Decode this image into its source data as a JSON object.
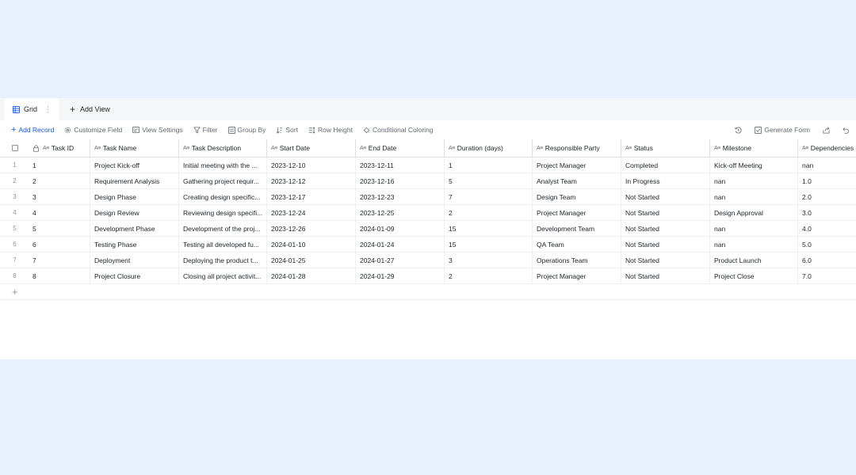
{
  "tabs": {
    "grid_label": "Grid",
    "add_view_label": "Add View"
  },
  "toolbar": {
    "add_record": "Add Record",
    "customize_field": "Customize Field",
    "view_settings": "View Settings",
    "filter": "Filter",
    "group_by": "Group By",
    "sort": "Sort",
    "row_height": "Row Height",
    "conditional_coloring": "Conditional Coloring",
    "generate_form": "Generate Form"
  },
  "columns": {
    "task_id": "Task ID",
    "task_name": "Task Name",
    "task_description": "Task Description",
    "start_date": "Start Date",
    "end_date": "End Date",
    "duration": "Duration (days)",
    "responsible_party": "Responsible Party",
    "status": "Status",
    "milestone": "Milestone",
    "dependencies": "Dependencies"
  },
  "rows": [
    {
      "idx": "1",
      "task_id": "1",
      "task_name": "Project Kick-off",
      "task_description": "Initial meeting with the ...",
      "start_date": "2023-12-10",
      "end_date": "2023-12-11",
      "duration": "1",
      "responsible_party": "Project Manager",
      "status": "Completed",
      "milestone": "Kick-off Meeting",
      "dependencies": "nan"
    },
    {
      "idx": "2",
      "task_id": "2",
      "task_name": "Requirement Analysis",
      "task_description": "Gathering project requir...",
      "start_date": "2023-12-12",
      "end_date": "2023-12-16",
      "duration": "5",
      "responsible_party": "Analyst Team",
      "status": "In Progress",
      "milestone": "nan",
      "dependencies": "1.0"
    },
    {
      "idx": "3",
      "task_id": "3",
      "task_name": "Design Phase",
      "task_description": "Creating design specific...",
      "start_date": "2023-12-17",
      "end_date": "2023-12-23",
      "duration": "7",
      "responsible_party": "Design Team",
      "status": "Not Started",
      "milestone": "nan",
      "dependencies": "2.0"
    },
    {
      "idx": "4",
      "task_id": "4",
      "task_name": "Design Review",
      "task_description": "Reviewing design specifi...",
      "start_date": "2023-12-24",
      "end_date": "2023-12-25",
      "duration": "2",
      "responsible_party": "Project Manager",
      "status": "Not Started",
      "milestone": "Design Approval",
      "dependencies": "3.0"
    },
    {
      "idx": "5",
      "task_id": "5",
      "task_name": "Development Phase",
      "task_description": "Development of the proj...",
      "start_date": "2023-12-26",
      "end_date": "2024-01-09",
      "duration": "15",
      "responsible_party": "Development Team",
      "status": "Not Started",
      "milestone": "nan",
      "dependencies": "4.0"
    },
    {
      "idx": "6",
      "task_id": "6",
      "task_name": "Testing Phase",
      "task_description": "Testing all developed fu...",
      "start_date": "2024-01-10",
      "end_date": "2024-01-24",
      "duration": "15",
      "responsible_party": "QA Team",
      "status": "Not Started",
      "milestone": "nan",
      "dependencies": "5.0"
    },
    {
      "idx": "7",
      "task_id": "7",
      "task_name": "Deployment",
      "task_description": "Deploying the product t...",
      "start_date": "2024-01-25",
      "end_date": "2024-01-27",
      "duration": "3",
      "responsible_party": "Operations Team",
      "status": "Not Started",
      "milestone": "Product Launch",
      "dependencies": "6.0"
    },
    {
      "idx": "8",
      "task_id": "8",
      "task_name": "Project Closure",
      "task_description": "Closing all project activit...",
      "start_date": "2024-01-28",
      "end_date": "2024-01-29",
      "duration": "2",
      "responsible_party": "Project Manager",
      "status": "Not Started",
      "milestone": "Project Close",
      "dependencies": "7.0"
    }
  ],
  "colors": {
    "accent": "#1456f0",
    "page_background": "#e8effd",
    "tabbar_background": "#f5f6f7"
  }
}
